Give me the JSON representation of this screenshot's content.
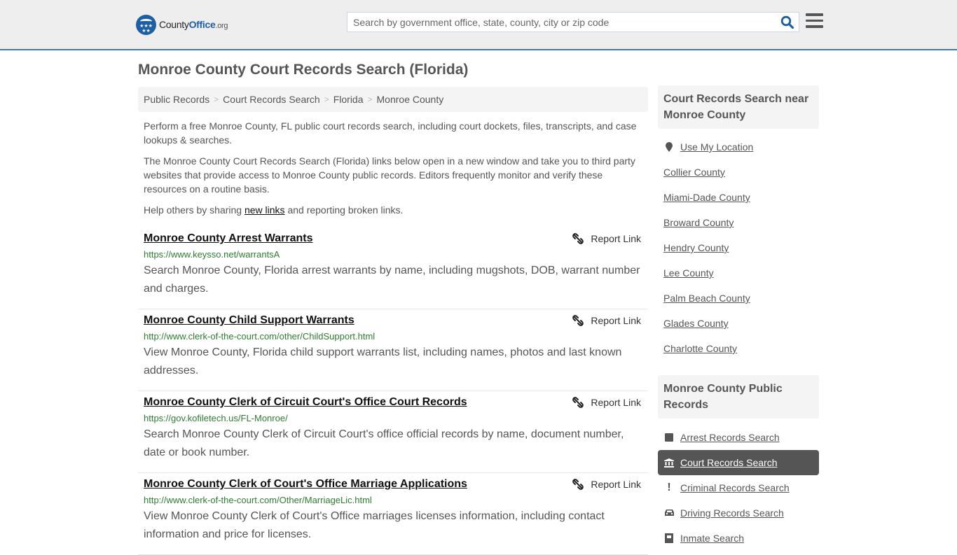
{
  "header": {
    "logo": {
      "name_part1": "County",
      "name_part2": "Office",
      "tld": ".org",
      "stars": "★★★ ★★"
    },
    "search": {
      "placeholder": "Search by government office, state, county, city or zip code",
      "value": ""
    }
  },
  "page": {
    "title": "Monroe County Court Records Search (Florida)",
    "breadcrumb": [
      "Public Records",
      "Court Records Search",
      "Florida",
      "Monroe County"
    ],
    "breadcrumb_separator": ">",
    "intro": {
      "p1": "Perform a free Monroe County, FL public court records search, including court dockets, files, transcripts, and case lookups & searches.",
      "p2": "The Monroe County Court Records Search (Florida) links below open in a new window and take you to third party websites that provide access to Monroe County public records. Editors frequently monitor and verify these resources on a routine basis.",
      "p3_before": "Help others by sharing ",
      "p3_link": "new links",
      "p3_after": " and reporting broken links."
    }
  },
  "results": [
    {
      "title": "Monroe County Arrest Warrants",
      "url": "https://www.keysso.net/warrantsA",
      "description": "Search Monroe County, Florida arrest warrants by name, including mugshots, DOB, warrant number and charges.",
      "report_label": "Report Link"
    },
    {
      "title": "Monroe County Child Support Warrants",
      "url": "http://www.clerk-of-the-court.com/other/ChildSupport.html",
      "description": "View Monroe County, Florida child support warrants list, including names, photos and last known addresses.",
      "report_label": "Report Link"
    },
    {
      "title": "Monroe County Clerk of Circuit Court's Office Court Records",
      "url": "https://gov.kofiletech.us/FL-Monroe/",
      "description": "Search Monroe County Clerk of Circuit Court's office official records by name, document number, date or book number.",
      "report_label": "Report Link"
    },
    {
      "title": "Monroe County Clerk of Court's Office Marriage Applications",
      "url": "http://www.clerk-of-the-court.com/Other/MarriageLic.html",
      "description": "View Monroe County Clerk of Court's Office marriages licenses information, including contact information and price for licenses.",
      "report_label": "Report Link"
    }
  ],
  "sidebar": {
    "nearby": {
      "heading": "Court Records Search near Monroe County",
      "use_location": "Use My Location",
      "counties": [
        "Collier County",
        "Miami-Dade County",
        "Broward County",
        "Hendry County",
        "Lee County",
        "Palm Beach County",
        "Glades County",
        "Charlotte County"
      ]
    },
    "public_records": {
      "heading": "Monroe County Public Records",
      "items": [
        {
          "label": "Arrest Records Search",
          "icon": "square-icon",
          "active": false
        },
        {
          "label": "Court Records Search",
          "icon": "courthouse-icon",
          "active": true
        },
        {
          "label": "Criminal Records Search",
          "icon": "exclamation-icon",
          "active": false
        },
        {
          "label": "Driving Records Search",
          "icon": "car-icon",
          "active": false
        },
        {
          "label": "Inmate Search",
          "icon": "inmate-icon",
          "active": false
        }
      ]
    }
  },
  "colors": {
    "brand": "#1d5fa5",
    "header_border": "#3a7bb0",
    "url_green": "#2e7d32",
    "active_bg": "#555555"
  }
}
